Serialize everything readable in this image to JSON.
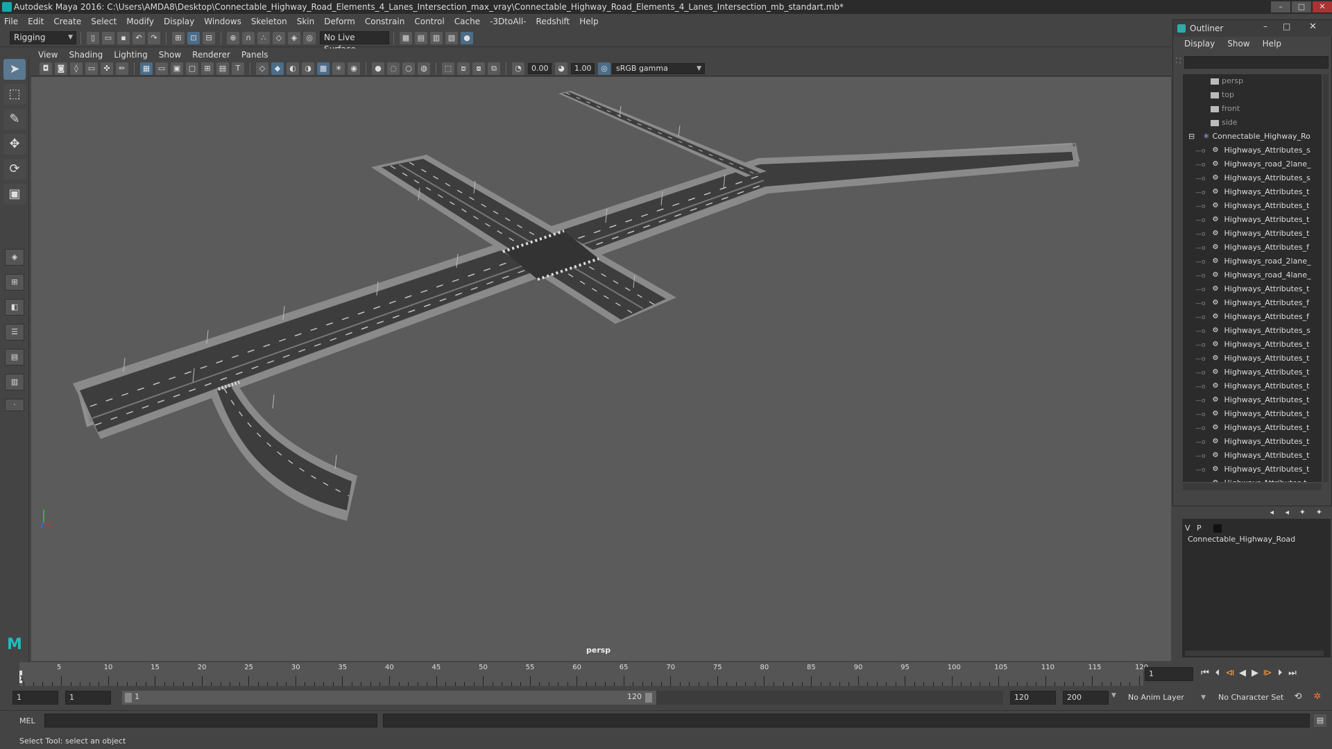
{
  "window": {
    "title": "Autodesk Maya 2016: C:\\Users\\AMDA8\\Desktop\\Connectable_Highway_Road_Elements_4_Lanes_Intersection_max_vray\\Connectable_Highway_Road_Elements_4_Lanes_Intersection_mb_standart.mb*"
  },
  "menubar": [
    "File",
    "Edit",
    "Create",
    "Select",
    "Modify",
    "Display",
    "Windows",
    "Skeleton",
    "Skin",
    "Deform",
    "Constrain",
    "Control",
    "Cache",
    "-3DtoAll-",
    "Redshift",
    "Help"
  ],
  "shelf": {
    "mode": "Rigging",
    "live_surface": "No Live Surface"
  },
  "viewport": {
    "menu": [
      "View",
      "Shading",
      "Lighting",
      "Show",
      "Renderer",
      "Panels"
    ],
    "exposure": "0.00",
    "gamma": "1.00",
    "color_space": "sRGB gamma",
    "camera_label": "persp"
  },
  "outliner": {
    "title": "Outliner",
    "menu": [
      "Display",
      "Show",
      "Help"
    ],
    "cameras": [
      "persp",
      "top",
      "front",
      "side"
    ],
    "group": "Connectable_Highway_Ro",
    "children": [
      "Highways_Attributes_s",
      "Highways_road_2lane_",
      "Highways_Attributes_s",
      "Highways_Attributes_t",
      "Highways_Attributes_t",
      "Highways_Attributes_t",
      "Highways_Attributes_t",
      "Highways_Attributes_f",
      "Highways_road_2lane_",
      "Highways_road_4lane_",
      "Highways_Attributes_t",
      "Highways_Attributes_f",
      "Highways_Attributes_f",
      "Highways_Attributes_s",
      "Highways_Attributes_t",
      "Highways_Attributes_t",
      "Highways_Attributes_t",
      "Highways_Attributes_t",
      "Highways_Attributes_t",
      "Highways_Attributes_t",
      "Highways_Attributes_t",
      "Highways_Attributes_t",
      "Highways_Attributes_t",
      "Highways_Attributes_t",
      "Highways Attributes t"
    ]
  },
  "layers": {
    "v": "V",
    "p": "P",
    "layer_name": "Connectable_Highway_Road"
  },
  "timeline": {
    "ticks": [
      "5",
      "10",
      "15",
      "20",
      "25",
      "30",
      "35",
      "40",
      "45",
      "50",
      "55",
      "60",
      "65",
      "70",
      "75",
      "80",
      "85",
      "90",
      "95",
      "100",
      "105",
      "110",
      "115",
      "120"
    ],
    "first": "1",
    "current_frame": "1"
  },
  "range": {
    "start": "1",
    "playback_start": "1",
    "slider_start": "1",
    "slider_end": "120",
    "playback_end": "120",
    "end": "200",
    "anim_layer": "No Anim Layer",
    "character_set": "No Character Set"
  },
  "command": {
    "label": "MEL"
  },
  "help_line": "Select Tool: select an object"
}
